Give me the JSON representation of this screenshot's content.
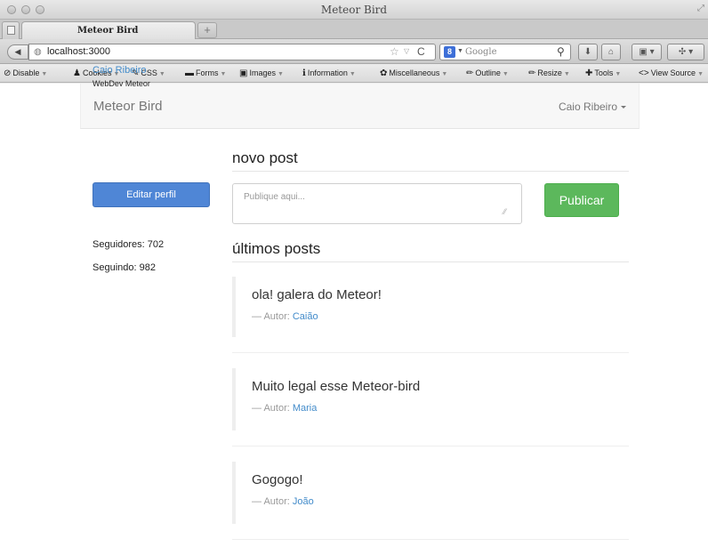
{
  "window": {
    "title": "Meteor Bird"
  },
  "tabs": [
    {
      "label": "Meteor Bird"
    }
  ],
  "new_tab": "+",
  "url": "localhost:3000",
  "search": {
    "engine": "8",
    "placeholder": "Google"
  },
  "devbar": [
    {
      "icon": "disable-icon",
      "glyph": "⊘",
      "label": "Disable"
    },
    {
      "icon": "cookies-icon",
      "glyph": "♟",
      "label": "Cookies"
    },
    {
      "icon": "css-icon",
      "glyph": "✎",
      "label": "CSS"
    },
    {
      "icon": "forms-icon",
      "glyph": "▬",
      "label": "Forms"
    },
    {
      "icon": "images-icon",
      "glyph": "▣",
      "label": "Images"
    },
    {
      "icon": "information-icon",
      "glyph": "ℹ",
      "label": "Information"
    },
    {
      "icon": "miscellaneous-icon",
      "glyph": "✿",
      "label": "Miscellaneous"
    },
    {
      "icon": "outline-icon",
      "glyph": "✏",
      "label": "Outline"
    },
    {
      "icon": "resize-icon",
      "glyph": "✏",
      "label": "Resize"
    },
    {
      "icon": "tools-icon",
      "glyph": "✚",
      "label": "Tools"
    },
    {
      "icon": "view-source-icon",
      "glyph": "<>",
      "label": "View Source"
    }
  ],
  "app": {
    "brand": "Meteor Bird",
    "user_menu": "Caio Ribeiro"
  },
  "profile": {
    "name": "Caio Ribeiro",
    "subtitle": "WebDev Meteor",
    "edit_button": "Editar perfil",
    "followers": "Seguidores: 702",
    "following": "Seguindo: 982"
  },
  "compose": {
    "title": "novo post",
    "placeholder": "Publique aqui...",
    "publish_button": "Publicar"
  },
  "feed": {
    "title": "últimos posts",
    "author_prefix": "— Autor:",
    "posts": [
      {
        "text": "ola! galera do Meteor!",
        "author": "Caião"
      },
      {
        "text": "Muito legal esse Meteor-bird",
        "author": "Maria"
      },
      {
        "text": "Gogogo!",
        "author": "João"
      }
    ]
  }
}
